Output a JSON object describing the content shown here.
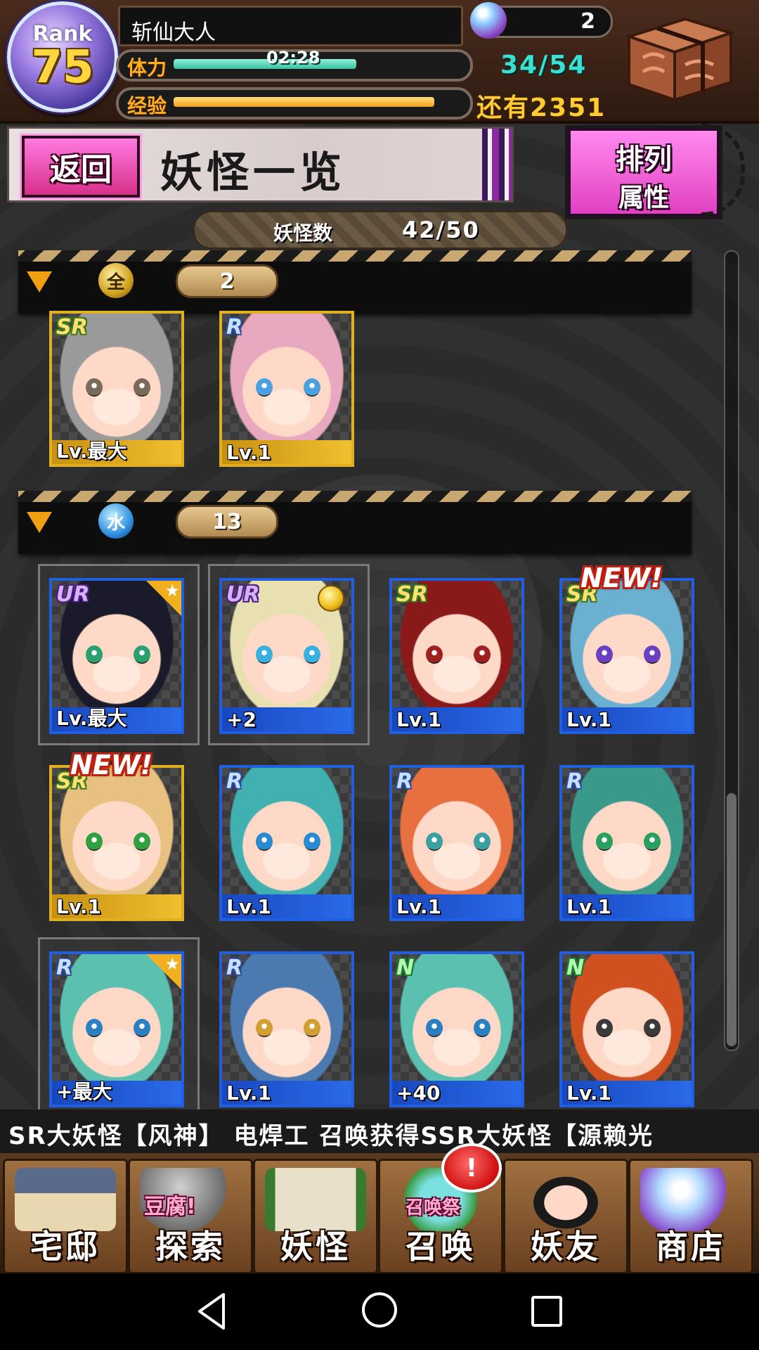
{
  "player": {
    "rank_label": "Rank",
    "rank": "75",
    "name": "斩仙大人",
    "stamina_label": "体力",
    "stamina_timer": "02:28",
    "stamina_count": "34/54",
    "stamina_fraction": 0.63,
    "exp_label": "经验",
    "exp_remaining": "还有2351",
    "exp_fraction": 0.9,
    "gems": "2"
  },
  "header": {
    "back_label": "返回",
    "title": "妖怪一览",
    "sort_line1": "排列",
    "sort_line2": "属性"
  },
  "yokai_count": {
    "label": "妖怪数",
    "value": "42/50"
  },
  "groups": [
    {
      "element": "earth-element-icon",
      "element_glyph": "全",
      "count": "2"
    },
    {
      "element": "water-element-icon",
      "element_glyph": "水",
      "count": "13"
    }
  ],
  "cards": [
    {
      "rarity": "SR",
      "level": "Lv.最大",
      "hair": "#9a9a9a",
      "eye": "#7a6a5a",
      "frame": "gold"
    },
    {
      "rarity": "R",
      "level": "Lv.1",
      "hair": "#e8a8c0",
      "eye": "#4aa0e0",
      "frame": "gold"
    },
    {
      "rarity": "UR",
      "level": "Lv.最大",
      "hair": "#1a1a2a",
      "eye": "#2aa070",
      "frame": "blue",
      "favorite": true,
      "selected": true
    },
    {
      "rarity": "UR",
      "level": "+2",
      "hair": "#e8e0b0",
      "eye": "#3ab0e0",
      "frame": "blue",
      "medal": true,
      "selected": true
    },
    {
      "rarity": "SR",
      "level": "Lv.1",
      "hair": "#8a1a1a",
      "eye": "#a02020",
      "frame": "blue"
    },
    {
      "rarity": "SR",
      "level": "Lv.1",
      "hair": "#6ab0d0",
      "eye": "#6a40c0",
      "frame": "blue",
      "new": true
    },
    {
      "rarity": "SR",
      "level": "Lv.1",
      "hair": "#e8c080",
      "eye": "#30a040",
      "frame": "gold",
      "new": true
    },
    {
      "rarity": "R",
      "level": "Lv.1",
      "hair": "#40b0b0",
      "eye": "#2a8ad0",
      "frame": "blue"
    },
    {
      "rarity": "R",
      "level": "Lv.1",
      "hair": "#e87040",
      "eye": "#3aa0a0",
      "frame": "blue"
    },
    {
      "rarity": "R",
      "level": "Lv.1",
      "hair": "#3a9a8a",
      "eye": "#2aa060",
      "frame": "blue"
    },
    {
      "rarity": "R",
      "level": "+最大",
      "hair": "#5ac0b0",
      "eye": "#2a80c0",
      "frame": "blue",
      "favorite": true,
      "selected": true
    },
    {
      "rarity": "R",
      "level": "Lv.1",
      "hair": "#4a7ab0",
      "eye": "#d0a030",
      "frame": "blue"
    },
    {
      "rarity": "N",
      "level": "+40",
      "hair": "#5ac0b0",
      "eye": "#2a80c0",
      "frame": "blue"
    },
    {
      "rarity": "N",
      "level": "Lv.1",
      "hair": "#d05020",
      "eye": "#3a3a3a",
      "frame": "blue"
    }
  ],
  "new_badge": "NEW!",
  "ticker": "SR大妖怪【风神】      电焊工 召唤获得SSR大妖怪【源赖光",
  "nav": {
    "items": [
      {
        "label": "宅邸"
      },
      {
        "label": "探索",
        "sub": "豆腐!"
      },
      {
        "label": "妖怪"
      },
      {
        "label": "召唤",
        "sub": "召唤祭"
      },
      {
        "label": "妖友"
      },
      {
        "label": "商店"
      }
    ],
    "alert": "!"
  },
  "colors": {
    "stamina": "#3ac0a0",
    "exp": "#f0a020",
    "accent_pink": "#e040c0",
    "card_gold": "#e0b020",
    "card_blue": "#2060e0"
  }
}
